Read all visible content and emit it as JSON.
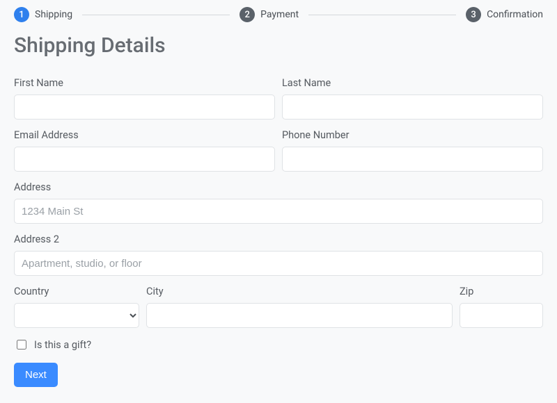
{
  "stepper": {
    "steps": [
      {
        "num": "1",
        "label": "Shipping",
        "active": true
      },
      {
        "num": "2",
        "label": "Payment",
        "active": false
      },
      {
        "num": "3",
        "label": "Confirmation",
        "active": false
      }
    ]
  },
  "title": "Shipping Details",
  "fields": {
    "first_name": {
      "label": "First Name",
      "value": ""
    },
    "last_name": {
      "label": "Last Name",
      "value": ""
    },
    "email": {
      "label": "Email Address",
      "value": ""
    },
    "phone": {
      "label": "Phone Number",
      "value": ""
    },
    "address": {
      "label": "Address",
      "placeholder": "1234 Main St",
      "value": ""
    },
    "address2": {
      "label": "Address 2",
      "placeholder": "Apartment, studio, or floor",
      "value": ""
    },
    "country": {
      "label": "Country",
      "value": ""
    },
    "city": {
      "label": "City",
      "value": ""
    },
    "zip": {
      "label": "Zip",
      "value": ""
    }
  },
  "gift": {
    "label": "Is this a gift?",
    "checked": false
  },
  "actions": {
    "next": "Next"
  }
}
